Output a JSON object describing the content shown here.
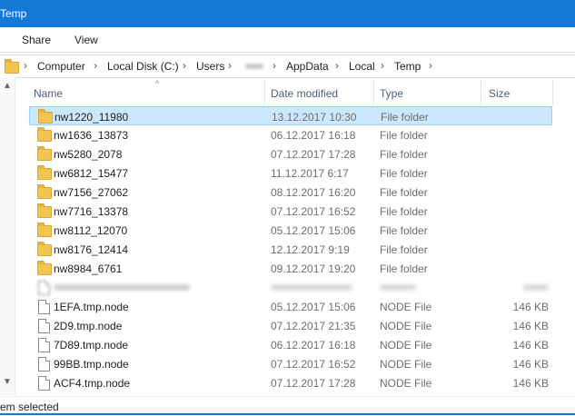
{
  "window": {
    "title": "Temp"
  },
  "ribbon": {
    "tabs": [
      "Share",
      "View"
    ]
  },
  "address": {
    "crumbs": [
      "Computer",
      "Local Disk (C:)",
      "Users",
      "AppData",
      "Local",
      "Temp"
    ]
  },
  "columns": {
    "name": "Name",
    "date": "Date modified",
    "type": "Type",
    "size": "Size"
  },
  "files": [
    {
      "name": "nw1220_11980",
      "date": "13.12.2017 10:30",
      "type": "File folder",
      "size": "",
      "icon": "folder-icon",
      "selected": true
    },
    {
      "name": "nw1636_13873",
      "date": "06.12.2017 16:18",
      "type": "File folder",
      "size": "",
      "icon": "folder-icon"
    },
    {
      "name": "nw5280_2078",
      "date": "07.12.2017 17:28",
      "type": "File folder",
      "size": "",
      "icon": "folder-icon"
    },
    {
      "name": "nw6812_15477",
      "date": "11.12.2017 6:17",
      "type": "File folder",
      "size": "",
      "icon": "folder-icon"
    },
    {
      "name": "nw7156_27062",
      "date": "08.12.2017 16:20",
      "type": "File folder",
      "size": "",
      "icon": "folder-icon"
    },
    {
      "name": "nw7716_13378",
      "date": "07.12.2017 16:52",
      "type": "File folder",
      "size": "",
      "icon": "folder-icon"
    },
    {
      "name": "nw8112_12070",
      "date": "05.12.2017 15:06",
      "type": "File folder",
      "size": "",
      "icon": "folder-icon"
    },
    {
      "name": "nw8176_12414",
      "date": "12.12.2017 9:19",
      "type": "File folder",
      "size": "",
      "icon": "folder-icon"
    },
    {
      "name": "nw8984_6761",
      "date": "09.12.2017 19:20",
      "type": "File folder",
      "size": "",
      "icon": "folder-icon"
    },
    {
      "name": "1EFA.tmp.node",
      "date": "05.12.2017 15:06",
      "type": "NODE File",
      "size": "146 KB",
      "icon": "file-icon"
    },
    {
      "name": "2D9.tmp.node",
      "date": "07.12.2017 21:35",
      "type": "NODE File",
      "size": "146 KB",
      "icon": "file-icon"
    },
    {
      "name": "7D89.tmp.node",
      "date": "06.12.2017 16:18",
      "type": "NODE File",
      "size": "146 KB",
      "icon": "file-icon"
    },
    {
      "name": "99BB.tmp.node",
      "date": "07.12.2017 16:52",
      "type": "NODE File",
      "size": "146 KB",
      "icon": "file-icon"
    },
    {
      "name": "ACF4.tmp.node",
      "date": "07.12.2017 17:28",
      "type": "NODE File",
      "size": "146 KB",
      "icon": "file-icon"
    }
  ],
  "status": {
    "text": "em selected"
  },
  "colors": {
    "accent": "#1479d4",
    "selection": "#cce8ff",
    "folder": "#f4c451"
  }
}
